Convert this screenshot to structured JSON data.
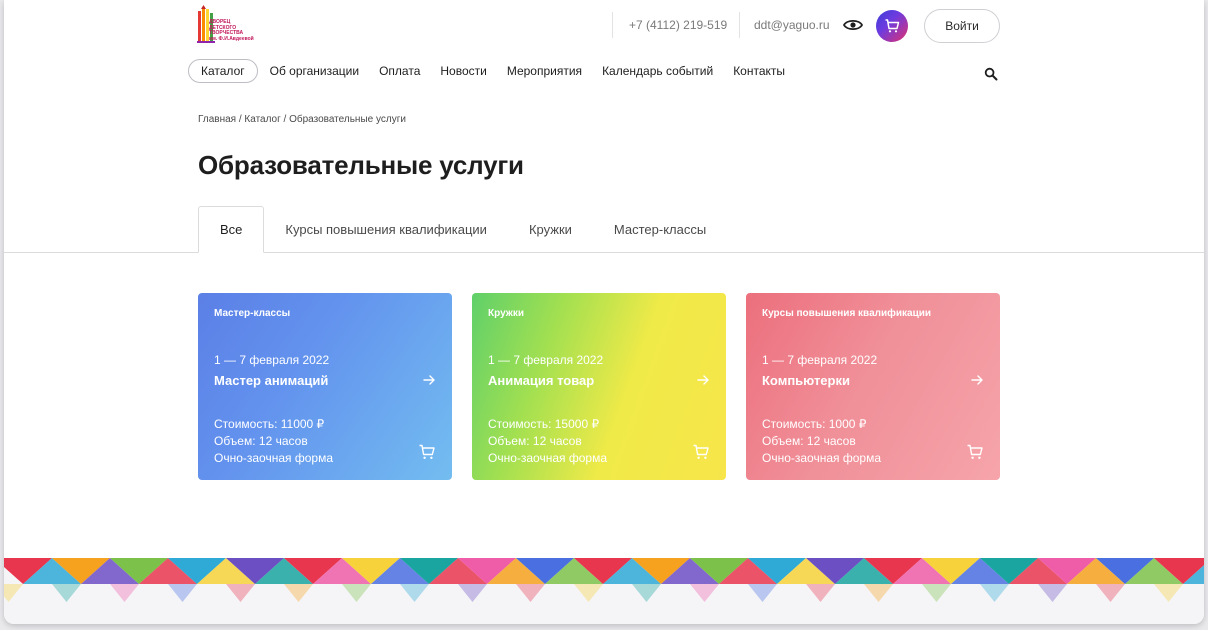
{
  "header": {
    "logo_lines": [
      "ДВОРЕЦ",
      "ДЕТСКОГО",
      "ТВОРЧЕСТВА",
      "им. Ф.И.Авдеевой"
    ],
    "phone": "+7 (4112) 219-519",
    "email": "ddt@yaguo.ru",
    "eye_icon": "eye-icon",
    "cart_icon": "cart-icon",
    "login_label": "Войти"
  },
  "nav": {
    "items": [
      {
        "label": "Каталог",
        "active": true
      },
      {
        "label": "Об организации"
      },
      {
        "label": "Оплата"
      },
      {
        "label": "Новости"
      },
      {
        "label": "Мероприятия"
      },
      {
        "label": "Календарь событий"
      },
      {
        "label": "Контакты"
      }
    ],
    "search_icon": "search-icon"
  },
  "breadcrumb": "Главная / Каталог / Образовательные услуги",
  "page_title": "Образовательные услуги",
  "tabs": [
    {
      "label": "Все",
      "active": true
    },
    {
      "label": "Курсы повышения квалификации"
    },
    {
      "label": "Кружки"
    },
    {
      "label": "Мастер-классы"
    }
  ],
  "cards": [
    {
      "category": "Мастер-классы",
      "date": "1 — 7 февраля 2022",
      "title": "Мастер анимаций",
      "price": "Стоимость: 11000 ₽",
      "volume": "Объем: 12 часов",
      "form": "Очно-заочная форма"
    },
    {
      "category": "Кружки",
      "date": "1 — 7 февраля 2022",
      "title": "Анимация товар",
      "price": "Стоимость: 15000 ₽",
      "volume": "Объем: 12 часов",
      "form": "Очно-заочная форма"
    },
    {
      "category": "Курсы повышения квалификации",
      "date": "1 — 7 февраля 2022",
      "title": "Компьютерки",
      "price": "Стоимость: 1000 ₽",
      "volume": "Объем: 12 часов",
      "form": "Очно-заочная форма"
    }
  ],
  "colors": {
    "card_blue": "#6393ee",
    "card_green_yellow": "#a4e050",
    "card_pink": "#f08f98",
    "cart_gradient_start": "#3a3fd6",
    "cart_gradient_end": "#e0316f"
  }
}
